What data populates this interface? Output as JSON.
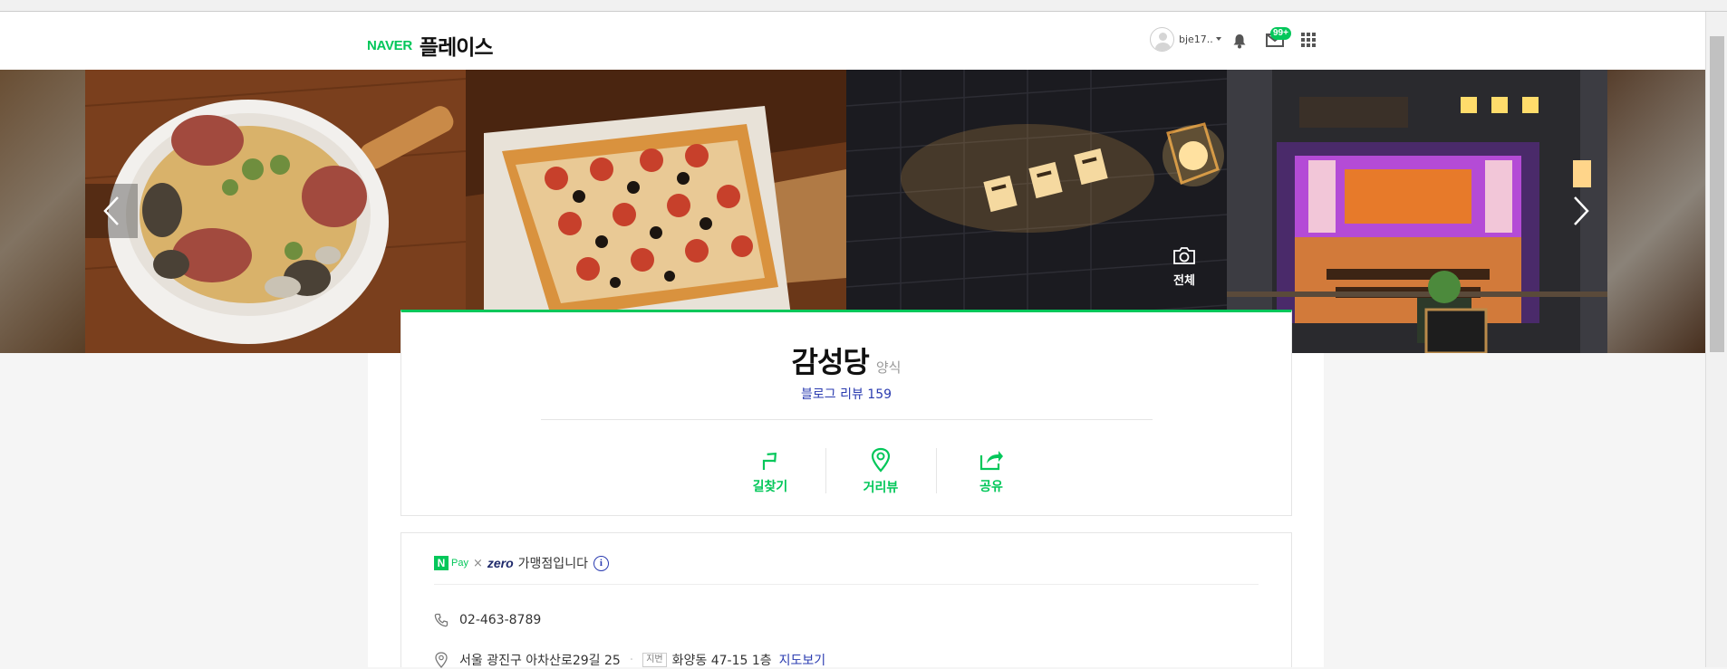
{
  "header": {
    "brand_naver": "NAVER",
    "brand_place": "플레이스",
    "username": "bje17..",
    "mail_badge": "99+"
  },
  "gallery": {
    "all_label": "전체",
    "icons": [
      "camera-icon",
      "chevron-left-icon",
      "chevron-right-icon"
    ]
  },
  "place": {
    "name": "감성당",
    "category": "양식",
    "blog_review": "블로그 리뷰 159",
    "actions": [
      {
        "label": "길찾기",
        "icon": "directions-icon"
      },
      {
        "label": "거리뷰",
        "icon": "location-pin-icon"
      },
      {
        "label": "공유",
        "icon": "share-icon"
      }
    ]
  },
  "info": {
    "npay_n": "N",
    "npay_word": "Pay",
    "times": "×",
    "zero": "zero",
    "pay_text": "가맹점입니다",
    "info_i": "i",
    "phone": "02-463-8789",
    "address": "서울 광진구 아차산로29길 25",
    "jibeon_tag": "지번",
    "jibeon_address": "화양동 47-15 1층",
    "map_link": "지도보기"
  },
  "colors": {
    "accent": "#03c75a",
    "link": "#2a3bb0"
  }
}
